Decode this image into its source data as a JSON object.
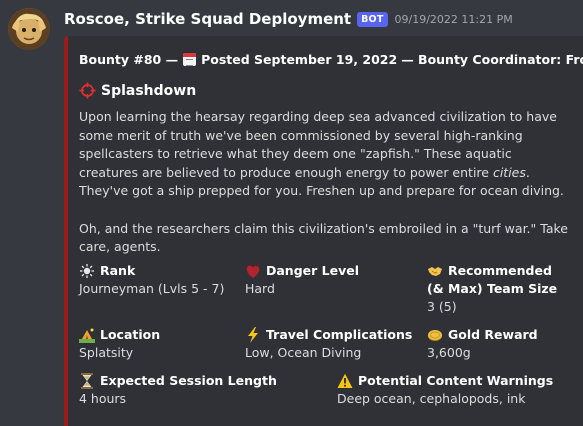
{
  "message": {
    "username": "Roscoe, Strike Squad Deployment",
    "badge": "BOT",
    "timestamp": "09/19/2022 11:21 PM"
  },
  "embed": {
    "accent_color": "#9e1b1b",
    "author_prefix": "Bounty #80 —",
    "author_date": "Posted September 19, 2022",
    "author_suffix": "— Bounty Coordinator: Frosty",
    "title": "Splashdown",
    "description_lines": [
      "Upon learning the hearsay regarding deep sea advanced civilization to have some merit of truth we've been commissioned by several high-ranking spellcasters to retrieve what they deem one \"zapfish.\" These aquatic creatures are believed to produce enough energy to power entire ",
      "cities",
      ".",
      "They've got a ship prepped for you. Freshen up and prepare for ocean diving.",
      "Oh, and the researchers claim this civilization's embroiled in a \"turf war.\" Take care, agents."
    ],
    "fields": [
      {
        "icon": "sun-icon",
        "name": "Rank",
        "value": "Journeyman (Lvls 5 - 7)"
      },
      {
        "icon": "anatomical-heart-icon",
        "name": "Danger Level",
        "value": "Hard"
      },
      {
        "icon": "handshake-icon",
        "name": "Recommended (& Max) Team Size",
        "name_line1": "Recommended",
        "name_line2": "(& Max) Team Size",
        "value": "3 (5)"
      },
      {
        "icon": "camping-icon",
        "name": "Location",
        "value": "Splatsity"
      },
      {
        "icon": "lightning-icon",
        "name": "Travel Complications",
        "value": "Low, Ocean Diving"
      },
      {
        "icon": "coin-icon",
        "name": "Gold Reward",
        "value": "3,600g"
      },
      {
        "icon": "hourglass-icon",
        "name": "Expected Session Length",
        "value": "4 hours"
      },
      {
        "icon": "warning-icon",
        "name": "Potential Content Warnings",
        "value": "Deep ocean, cephalopods, ink"
      }
    ]
  }
}
